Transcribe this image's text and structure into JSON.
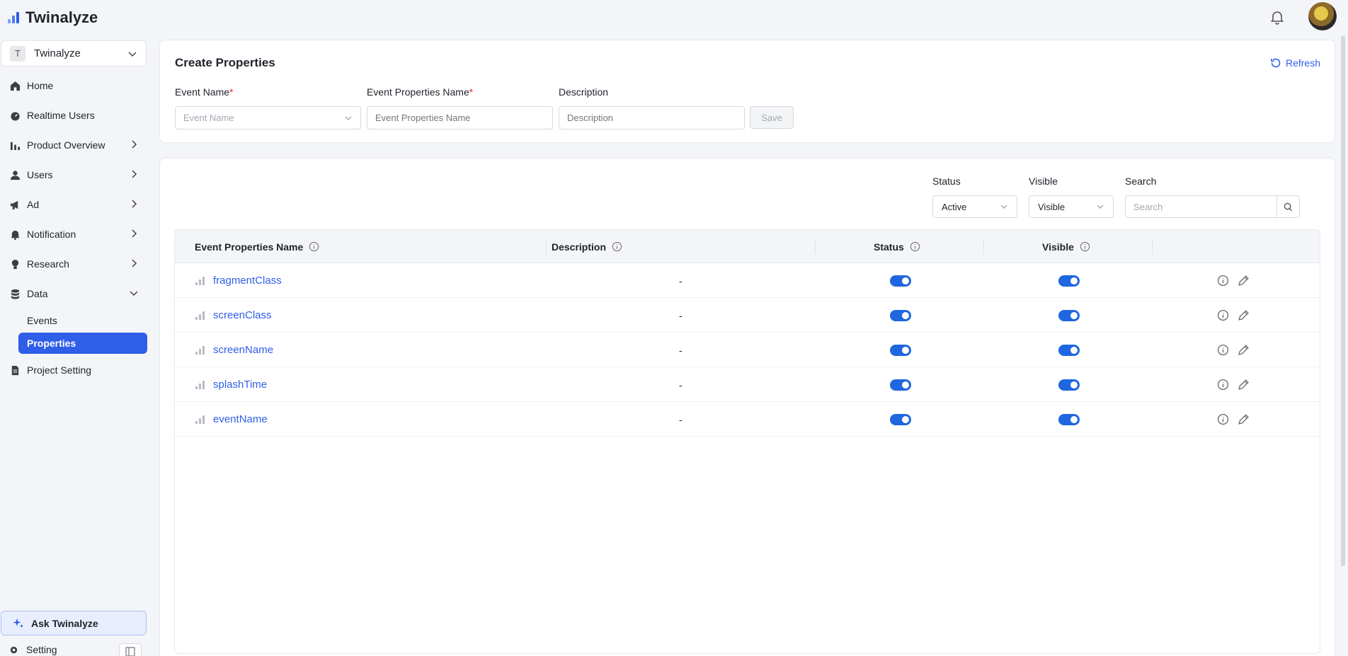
{
  "app": {
    "name": "Twinalyze"
  },
  "header": {
    "notification_icon": "bell-icon",
    "avatar_icon": "user-avatar"
  },
  "sidebar": {
    "project": {
      "badge": "T",
      "name": "Twinalyze"
    },
    "items": [
      {
        "label": "Home",
        "icon": "home-icon",
        "chevron": ""
      },
      {
        "label": "Realtime Users",
        "icon": "gauge-icon",
        "chevron": ""
      },
      {
        "label": "Product Overview",
        "icon": "bar-chart-icon",
        "chevron": "right"
      },
      {
        "label": "Users",
        "icon": "user-icon",
        "chevron": "right"
      },
      {
        "label": "Ad",
        "icon": "megaphone-icon",
        "chevron": "right"
      },
      {
        "label": "Notification",
        "icon": "bell-icon",
        "chevron": "right"
      },
      {
        "label": "Research",
        "icon": "bulb-icon",
        "chevron": "right"
      },
      {
        "label": "Data",
        "icon": "database-icon",
        "chevron": "down"
      }
    ],
    "data_sub_items": [
      {
        "label": "Events",
        "active": false
      },
      {
        "label": "Properties",
        "active": true
      }
    ],
    "project_setting": {
      "label": "Project Setting",
      "icon": "document-icon"
    },
    "ask": {
      "label": "Ask Twinalyze",
      "icon": "sparkle-icon"
    },
    "setting": {
      "label": "Setting",
      "icon": "gear-icon"
    }
  },
  "create": {
    "title": "Create Properties",
    "refresh_label": "Refresh",
    "event_name": {
      "label": "Event Name",
      "required": "*",
      "placeholder": "Event Name"
    },
    "property_name": {
      "label": "Event Properties Name",
      "required": "*",
      "placeholder": "Event Properties Name"
    },
    "description": {
      "label": "Description",
      "placeholder": "Description"
    },
    "save_label": "Save"
  },
  "filters": {
    "status": {
      "label": "Status",
      "value": "Active"
    },
    "visible": {
      "label": "Visible",
      "value": "Visible"
    },
    "search": {
      "label": "Search",
      "placeholder": "Search"
    }
  },
  "table": {
    "columns": {
      "name": "Event Properties Name",
      "description": "Description",
      "status": "Status",
      "visible": "Visible"
    },
    "rows": [
      {
        "name": "fragmentClass",
        "description": "-",
        "status": true,
        "visible": true
      },
      {
        "name": "screenClass",
        "description": "-",
        "status": true,
        "visible": true
      },
      {
        "name": "screenName",
        "description": "-",
        "status": true,
        "visible": true
      },
      {
        "name": "splashTime",
        "description": "-",
        "status": true,
        "visible": true
      },
      {
        "name": "eventName",
        "description": "-",
        "status": true,
        "visible": true
      }
    ]
  },
  "colors": {
    "accent": "#2f5ee8",
    "toggle_on": "#1f66e0",
    "required": "#e0242d"
  }
}
